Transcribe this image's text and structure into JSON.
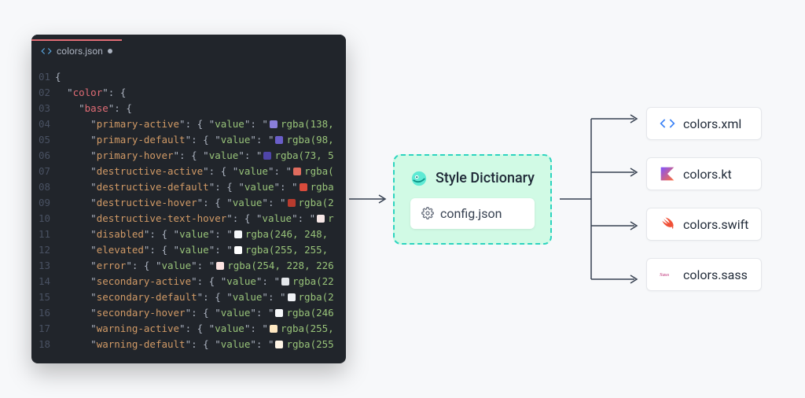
{
  "editor": {
    "filename": "colors.json",
    "lines": [
      {
        "num": "01",
        "indent": 0,
        "type": "punct",
        "text": "{"
      },
      {
        "num": "02",
        "indent": 1,
        "type": "key1",
        "key": "color",
        "after": ": {"
      },
      {
        "num": "03",
        "indent": 2,
        "type": "key1",
        "key": "base",
        "after": ": {"
      },
      {
        "num": "04",
        "indent": 3,
        "type": "prop",
        "key": "primary-active",
        "swatch": "#8a7edb",
        "value": "rgba(138,"
      },
      {
        "num": "05",
        "indent": 3,
        "type": "prop",
        "key": "primary-default",
        "swatch": "#6a5ec9",
        "value": "rgba(98,"
      },
      {
        "num": "06",
        "indent": 3,
        "type": "prop",
        "key": "primary-hover",
        "swatch": "#4f45a8",
        "value": "rgba(73, 5"
      },
      {
        "num": "07",
        "indent": 3,
        "type": "prop",
        "key": "destructive-active",
        "swatch": "#e06c5e",
        "value": "rgba("
      },
      {
        "num": "08",
        "indent": 3,
        "type": "prop",
        "key": "destructive-default",
        "swatch": "#d94b3c",
        "value": "rgba"
      },
      {
        "num": "09",
        "indent": 3,
        "type": "prop",
        "key": "destructive-hover",
        "swatch": "#b73b2e",
        "value": "rgba(2"
      },
      {
        "num": "10",
        "indent": 3,
        "type": "prop",
        "key": "destructive-text-hover",
        "swatch": "#f6e7e6",
        "value": "r"
      },
      {
        "num": "11",
        "indent": 3,
        "type": "prop",
        "key": "disabled",
        "swatch": "#f6f8fa",
        "value": "rgba(246, 248,"
      },
      {
        "num": "12",
        "indent": 3,
        "type": "prop",
        "key": "elevated",
        "swatch": "#ffffff",
        "value": "rgba(255, 255,"
      },
      {
        "num": "13",
        "indent": 3,
        "type": "prop",
        "key": "error",
        "swatch": "#fee4e2",
        "value": "rgba(254, 228, 226"
      },
      {
        "num": "14",
        "indent": 3,
        "type": "prop",
        "key": "secondary-active",
        "swatch": "#e4e7eb",
        "value": "rgba(22"
      },
      {
        "num": "15",
        "indent": 3,
        "type": "prop",
        "key": "secondary-default",
        "swatch": "#f0f2f5",
        "value": "rgba(2"
      },
      {
        "num": "16",
        "indent": 3,
        "type": "prop",
        "key": "secondary-hover",
        "swatch": "#f6f8fa",
        "value": "rgba(246"
      },
      {
        "num": "17",
        "indent": 3,
        "type": "prop",
        "key": "warning-active",
        "swatch": "#ffe8c2",
        "value": "rgba(255,"
      },
      {
        "num": "18",
        "indent": 3,
        "type": "prop",
        "key": "warning-default",
        "swatch": "#fff5e6",
        "value": "rgba(255"
      }
    ]
  },
  "middle": {
    "title": "Style Dictionary",
    "config_label": "config.json"
  },
  "outputs": [
    {
      "id": "xml",
      "label": "colors.xml",
      "icon": "code"
    },
    {
      "id": "kt",
      "label": "colors.kt",
      "icon": "kotlin"
    },
    {
      "id": "swift",
      "label": "colors.swift",
      "icon": "swift"
    },
    {
      "id": "sass",
      "label": "colors.sass",
      "icon": "sass"
    }
  ],
  "colors": {
    "accent_teal": "#2dd4bf",
    "kotlin_a": "#7f52ff",
    "kotlin_b": "#ff6f3d",
    "swift": "#f05138",
    "sass": "#cf649a",
    "code_blue": "#3b82f6"
  }
}
